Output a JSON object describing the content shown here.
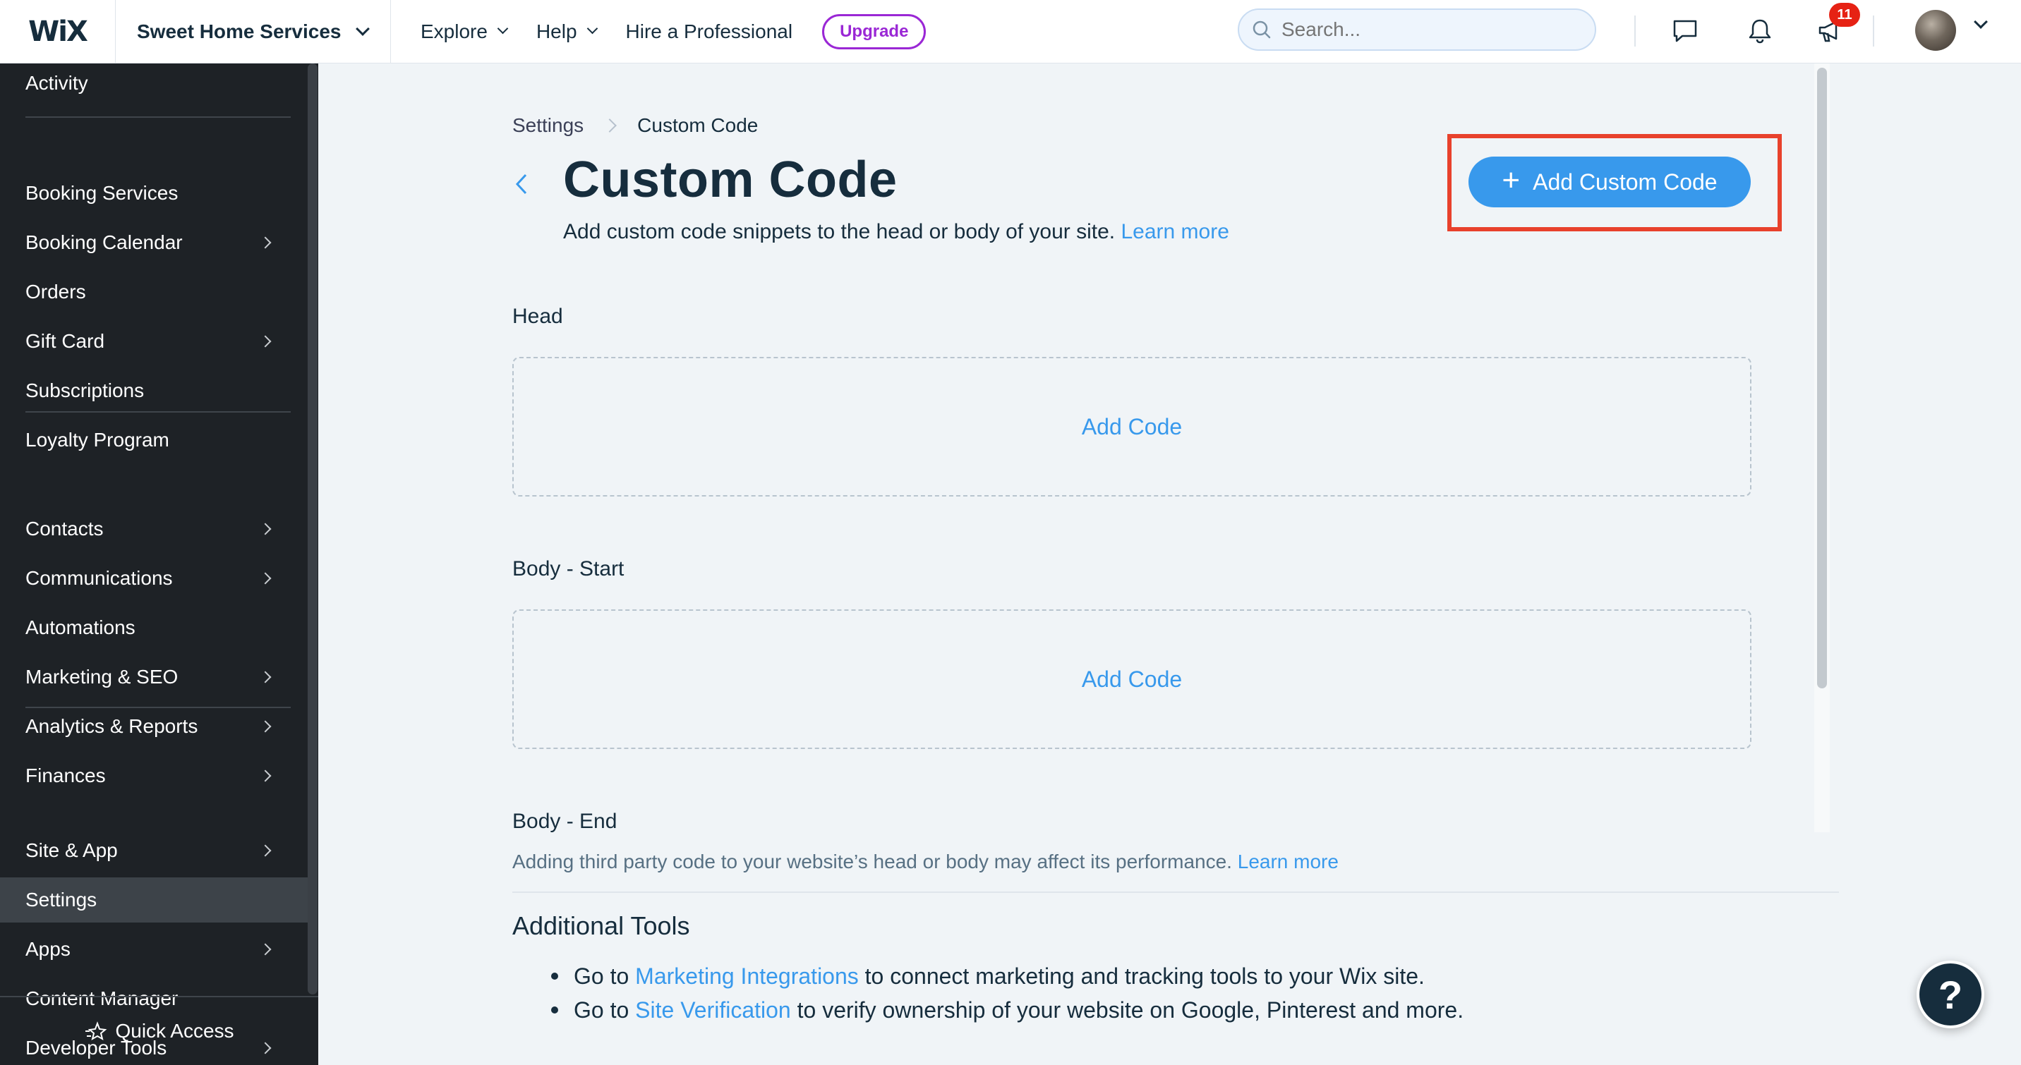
{
  "topbar": {
    "logo": "WiX",
    "site_name": "Sweet Home Services",
    "nav": [
      {
        "label": "Explore"
      },
      {
        "label": "Help"
      },
      {
        "label": "Hire a Professional"
      }
    ],
    "upgrade_label": "Upgrade",
    "search_placeholder": "Search...",
    "notifications_badge": "11",
    "icons": [
      "chat-icon",
      "bell-icon",
      "megaphone-icon",
      "avatar"
    ]
  },
  "sidebar": {
    "items": [
      {
        "label": "Activity",
        "has_submenu": false
      },
      {
        "label": "Booking Services",
        "has_submenu": false
      },
      {
        "label": "Booking Calendar",
        "has_submenu": true
      },
      {
        "label": "Orders",
        "has_submenu": false
      },
      {
        "label": "Gift Card",
        "has_submenu": true
      },
      {
        "label": "Subscriptions",
        "has_submenu": false
      },
      {
        "label": "Loyalty Program",
        "has_submenu": false
      },
      {
        "label": "Contacts",
        "has_submenu": true
      },
      {
        "label": "Communications",
        "has_submenu": true
      },
      {
        "label": "Automations",
        "has_submenu": false
      },
      {
        "label": "Marketing & SEO",
        "has_submenu": true
      },
      {
        "label": "Analytics & Reports",
        "has_submenu": true
      },
      {
        "label": "Finances",
        "has_submenu": true
      },
      {
        "label": "Site & App",
        "has_submenu": true
      },
      {
        "label": "Settings",
        "has_submenu": false,
        "active": true
      },
      {
        "label": "Apps",
        "has_submenu": true
      },
      {
        "label": "Content Manager",
        "has_submenu": false
      },
      {
        "label": "Developer Tools",
        "has_submenu": true
      }
    ],
    "quick_access": "Quick Access"
  },
  "main": {
    "breadcrumb": [
      "Settings",
      "Custom Code"
    ],
    "title": "Custom Code",
    "subtitle": "Add custom code snippets to the head or body of your site.",
    "subtitle_link": "Learn more",
    "add_button": "Add Custom Code",
    "sections": [
      {
        "label": "Head",
        "action": "Add Code"
      },
      {
        "label": "Body - Start",
        "action": "Add Code"
      },
      {
        "label": "Body - End"
      }
    ],
    "warning": "Adding third party code to your website’s head or body may affect its performance.",
    "warning_link": "Learn more",
    "additional_tools": {
      "title": "Additional Tools",
      "items": [
        {
          "prefix": "Go to",
          "link": "Marketing Integrations",
          "suffix": "to connect marketing and tracking tools to your Wix site."
        },
        {
          "prefix": "Go to",
          "link": "Site Verification",
          "suffix": "to verify ownership of your website on Google, Pinterest and more."
        }
      ]
    },
    "help_label": "?"
  },
  "colors": {
    "accent": "#3899ec",
    "highlight": "#e8412c",
    "sidebar_bg": "#1e2226",
    "upgrade": "#9a27d5",
    "badge": "#e62214"
  }
}
